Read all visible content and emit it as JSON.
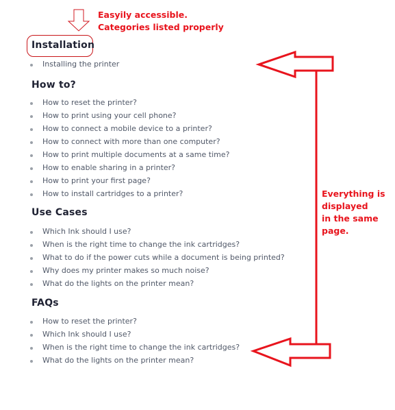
{
  "annotations": {
    "top_note": [
      "Easyily accessible.",
      "Categories listed properly"
    ],
    "side_note": [
      "Everything is",
      "displayed",
      "in the same",
      "page."
    ],
    "color": "#e8141d"
  },
  "sections": [
    {
      "title": "Installation",
      "items": [
        "Installing the printer"
      ]
    },
    {
      "title": "How to?",
      "items": [
        "How to reset the printer?",
        "How to print using your cell phone?",
        "How to connect a mobile device to a printer?",
        "How to connect with more than one computer?",
        "How to print multiple documents at a same time?",
        "How to enable sharing in a printer?",
        "How to print your first page?",
        "How to install cartridges to a printer?"
      ]
    },
    {
      "title": "Use Cases",
      "items": [
        "Which Ink should I use?",
        "When is the right time to change the ink cartridges?",
        "What to do if the power cuts while a document is being printed?",
        "Why does my printer makes so much noise?",
        "What do the lights on the printer mean?"
      ]
    },
    {
      "title": "FAQs",
      "items": [
        "How to reset the printer?",
        "Which Ink should I use?",
        "When is the right time to change the ink cartridges?",
        "What do the lights on the printer mean?"
      ]
    }
  ]
}
